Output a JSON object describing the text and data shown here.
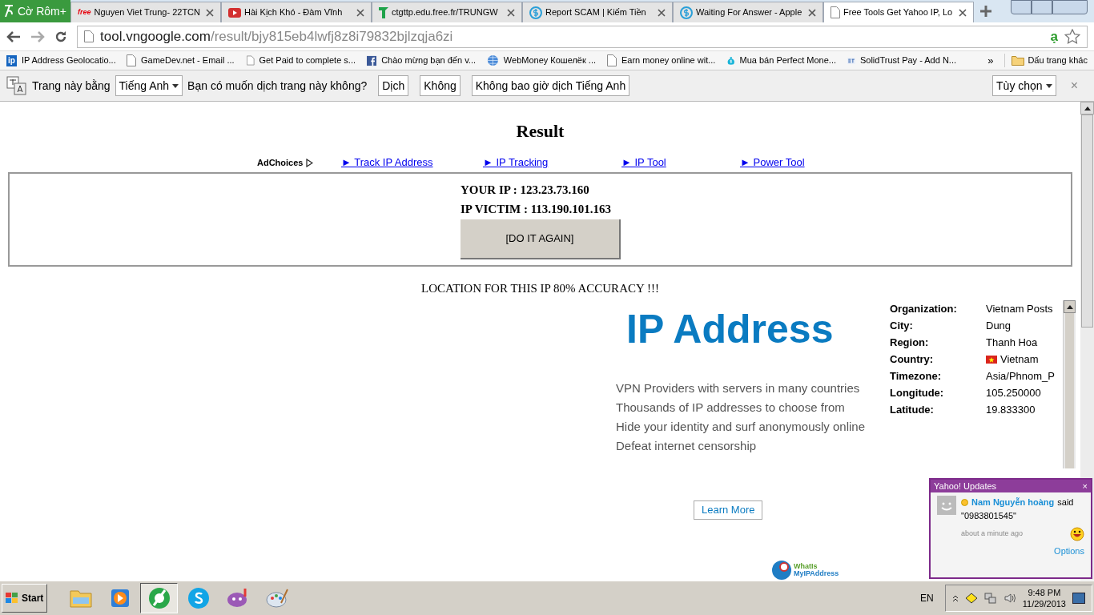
{
  "browser": {
    "logo": "Cờ Rôm+",
    "tabs": [
      {
        "title": "Nguyen Viet Trung- 22TCN",
        "kind": "free",
        "selected": false
      },
      {
        "title": "Hài Kịch Khó - Đàm Vĩnh",
        "kind": "video",
        "selected": false
      },
      {
        "title": "ctgttp.edu.free.fr/TRUNGW",
        "kind": "leaf",
        "selected": false
      },
      {
        "title": "Report SCAM | Kiếm Tiền",
        "kind": "dollar",
        "selected": false
      },
      {
        "title": "Waiting For Answer - Apple",
        "kind": "dollar",
        "selected": false
      },
      {
        "title": "Free Tools Get Yahoo IP, Lo",
        "kind": "page",
        "selected": true
      }
    ],
    "url_host": "tool.vngoogle.com",
    "url_path": "/result/bjy815eb4lwfj8z8i79832bjlzqja6zi",
    "extension_label": "ạ",
    "bookmarks": [
      {
        "label": "IP Address Geolocatio...",
        "kind": "ip"
      },
      {
        "label": "GameDev.net - Email ...",
        "kind": "page"
      },
      {
        "label": "Get Paid to complete s...",
        "kind": "page"
      },
      {
        "label": "Chào mừng bạn đến v...",
        "kind": "facebook"
      },
      {
        "label": "WebMoney Кошелёк ...",
        "kind": "globe"
      },
      {
        "label": "Earn money online wit...",
        "kind": "page"
      },
      {
        "label": "Mua bán Perfect Mone...",
        "kind": "bag"
      },
      {
        "label": "SolidTrust Pay - Add N...",
        "kind": "stp"
      }
    ],
    "bookmarks_overflow": "»",
    "other_bookmarks": "Dấu trang khác"
  },
  "translate_bar": {
    "prefix": "Trang này bằng",
    "language": "Tiếng Anh",
    "question": "Bạn có muốn dịch trang này không?",
    "buttons": [
      "Dịch",
      "Không",
      "Không bao giờ dịch Tiếng Anh"
    ],
    "options": "Tùy chọn",
    "close": "×"
  },
  "page": {
    "title": "Result",
    "adchoices": "AdChoices",
    "links": [
      "► Track IP Address",
      "► IP Tracking",
      "► IP Tool",
      "► Power Tool"
    ],
    "your_ip": "YOUR IP : 123.23.73.160",
    "victim_ip": "IP VICTIM : 113.190.101.163",
    "again_button": "[DO IT AGAIN]",
    "location_heading": "LOCATION FOR THIS IP 80% ACCURACY !!!",
    "ad": {
      "heading": "IP Address",
      "lines": [
        "VPN Providers with servers in many countries",
        "Thousands of IP addresses to choose from",
        "Hide your identity and surf anonymously online",
        "Defeat internet censorship"
      ],
      "button": "Learn More",
      "logo_top": "WhatIs",
      "logo_bottom": "MyIPAddress"
    },
    "info": [
      {
        "label": "Organization:",
        "value": "Vietnam Posts"
      },
      {
        "label": "City:",
        "value": "Dung"
      },
      {
        "label": "Region:",
        "value": "Thanh Hoa"
      },
      {
        "label": "Country:",
        "value": "Vietnam",
        "flag": true
      },
      {
        "label": "Timezone:",
        "value": "Asia/Phnom_P"
      },
      {
        "label": "Longitude:",
        "value": "105.250000"
      },
      {
        "label": "Latitude:",
        "value": "19.833300"
      }
    ]
  },
  "notification": {
    "title": "Yahoo! Updates",
    "close": "×",
    "sender": "Nam Nguyễn hoàng",
    "verb": "said",
    "message": "\"0983801545\"",
    "time": "about a minute ago",
    "options": "Options"
  },
  "taskbar": {
    "start": "Start",
    "apps": [
      {
        "kind": "folder",
        "selected": false
      },
      {
        "kind": "media",
        "selected": false
      },
      {
        "kind": "browser",
        "selected": true
      },
      {
        "kind": "skype",
        "selected": false
      },
      {
        "kind": "messenger",
        "selected": false
      },
      {
        "kind": "paint",
        "selected": false
      }
    ],
    "language": "EN",
    "time": "9:48 PM",
    "date": "11/29/2013"
  }
}
